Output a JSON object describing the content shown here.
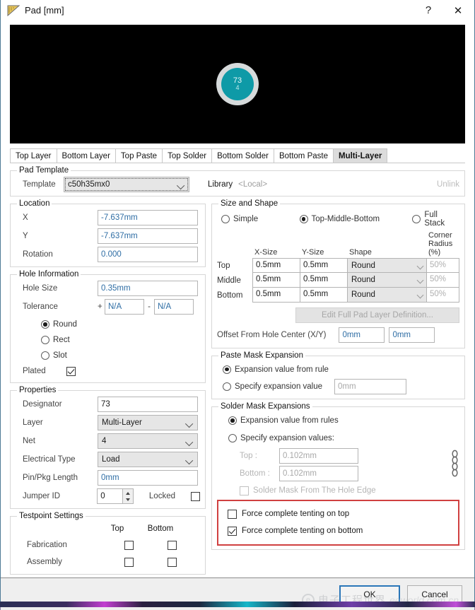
{
  "window": {
    "title": "Pad [mm]",
    "icon": "pad-icon",
    "help_label": "?",
    "close_label": "✕"
  },
  "preview": {
    "designator": "73",
    "net": "4",
    "pad_color": "#0e9aa7",
    "ring_color": "#d6dadb",
    "background": "#000000"
  },
  "tabs": [
    {
      "label": "Top Layer",
      "active": false
    },
    {
      "label": "Bottom Layer",
      "active": false
    },
    {
      "label": "Top Paste",
      "active": false
    },
    {
      "label": "Top Solder",
      "active": false
    },
    {
      "label": "Bottom Solder",
      "active": false
    },
    {
      "label": "Bottom Paste",
      "active": false
    },
    {
      "label": "Multi-Layer",
      "active": true
    }
  ],
  "pad_template": {
    "legend": "Pad Template",
    "template_label": "Template",
    "template_value": "c50h35mx0",
    "library_label": "Library",
    "library_value": "<Local>",
    "unlink_label": "Unlink"
  },
  "location": {
    "legend": "Location",
    "x_label": "X",
    "x_value": "-7.637mm",
    "y_label": "Y",
    "y_value": "-7.637mm",
    "rotation_label": "Rotation",
    "rotation_value": "0.000"
  },
  "hole": {
    "legend": "Hole Information",
    "hole_size_label": "Hole Size",
    "hole_size_value": "0.35mm",
    "tolerance_label": "Tolerance",
    "tol_plus_sign": "+",
    "tol_plus_value": "N/A",
    "tol_minus_sign": "-",
    "tol_minus_value": "N/A",
    "shapes": [
      {
        "label": "Round",
        "selected": true
      },
      {
        "label": "Rect",
        "selected": false
      },
      {
        "label": "Slot",
        "selected": false
      }
    ],
    "plated_label": "Plated",
    "plated_checked": true
  },
  "properties": {
    "legend": "Properties",
    "designator_label": "Designator",
    "designator_value": "73",
    "layer_label": "Layer",
    "layer_value": "Multi-Layer",
    "net_label": "Net",
    "net_value": "4",
    "electrical_type_label": "Electrical Type",
    "electrical_type_value": "Load",
    "pin_pkg_label": "Pin/Pkg Length",
    "pin_pkg_value": "0mm",
    "jumper_label": "Jumper ID",
    "jumper_value": "0",
    "locked_label": "Locked",
    "locked_checked": false
  },
  "testpoint": {
    "legend": "Testpoint Settings",
    "top_label": "Top",
    "bottom_label": "Bottom",
    "rows": [
      {
        "label": "Fabrication",
        "top_checked": false,
        "bottom_checked": false
      },
      {
        "label": "Assembly",
        "top_checked": false,
        "bottom_checked": false
      }
    ]
  },
  "size_shape": {
    "legend": "Size and Shape",
    "modes": [
      {
        "label": "Simple",
        "selected": false
      },
      {
        "label": "Top-Middle-Bottom",
        "selected": true
      },
      {
        "label": "Full Stack",
        "selected": false
      }
    ],
    "headers": {
      "x_size": "X-Size",
      "y_size": "Y-Size",
      "shape": "Shape",
      "corner_radius_l1": "Corner",
      "corner_radius_l2": "Radius (%)"
    },
    "rows": [
      {
        "name": "Top",
        "x_size": "0.5mm",
        "y_size": "0.5mm",
        "shape": "Round",
        "corner_radius": "50%"
      },
      {
        "name": "Middle",
        "x_size": "0.5mm",
        "y_size": "0.5mm",
        "shape": "Round",
        "corner_radius": "50%"
      },
      {
        "name": "Bottom",
        "x_size": "0.5mm",
        "y_size": "0.5mm",
        "shape": "Round",
        "corner_radius": "50%"
      }
    ],
    "edit_full_stack_label": "Edit Full Pad Layer Definition...",
    "offset_label": "Offset From Hole Center (X/Y)",
    "offset_x": "0mm",
    "offset_y": "0mm"
  },
  "paste_mask": {
    "legend": "Paste Mask Expansion",
    "from_rule_label": "Expansion value from rule",
    "from_rule_selected": true,
    "specify_label": "Specify expansion value",
    "specify_selected": false,
    "specify_value": "0mm"
  },
  "solder_mask": {
    "legend": "Solder Mask Expansions",
    "from_rules_label": "Expansion value from rules",
    "from_rules_selected": true,
    "specify_label": "Specify expansion values:",
    "specify_selected": false,
    "top_label": "Top :",
    "top_value": "0.102mm",
    "bottom_label": "Bottom :",
    "bottom_value": "0.102mm",
    "link_icon": "chain-link-icon",
    "from_hole_edge_label": "Solder Mask From The Hole Edge",
    "from_hole_edge_checked": false,
    "tenting_top_label": "Force complete tenting on top",
    "tenting_top_checked": false,
    "tenting_bottom_label": "Force complete tenting on bottom",
    "tenting_bottom_checked": true,
    "highlight_color": "#d04040"
  },
  "footer": {
    "ok_label": "OK",
    "cancel_label": "Cancel"
  },
  "watermark": {
    "cn": "电子工程世界",
    "en": "eeworld.com.cn",
    "badge": "e"
  }
}
